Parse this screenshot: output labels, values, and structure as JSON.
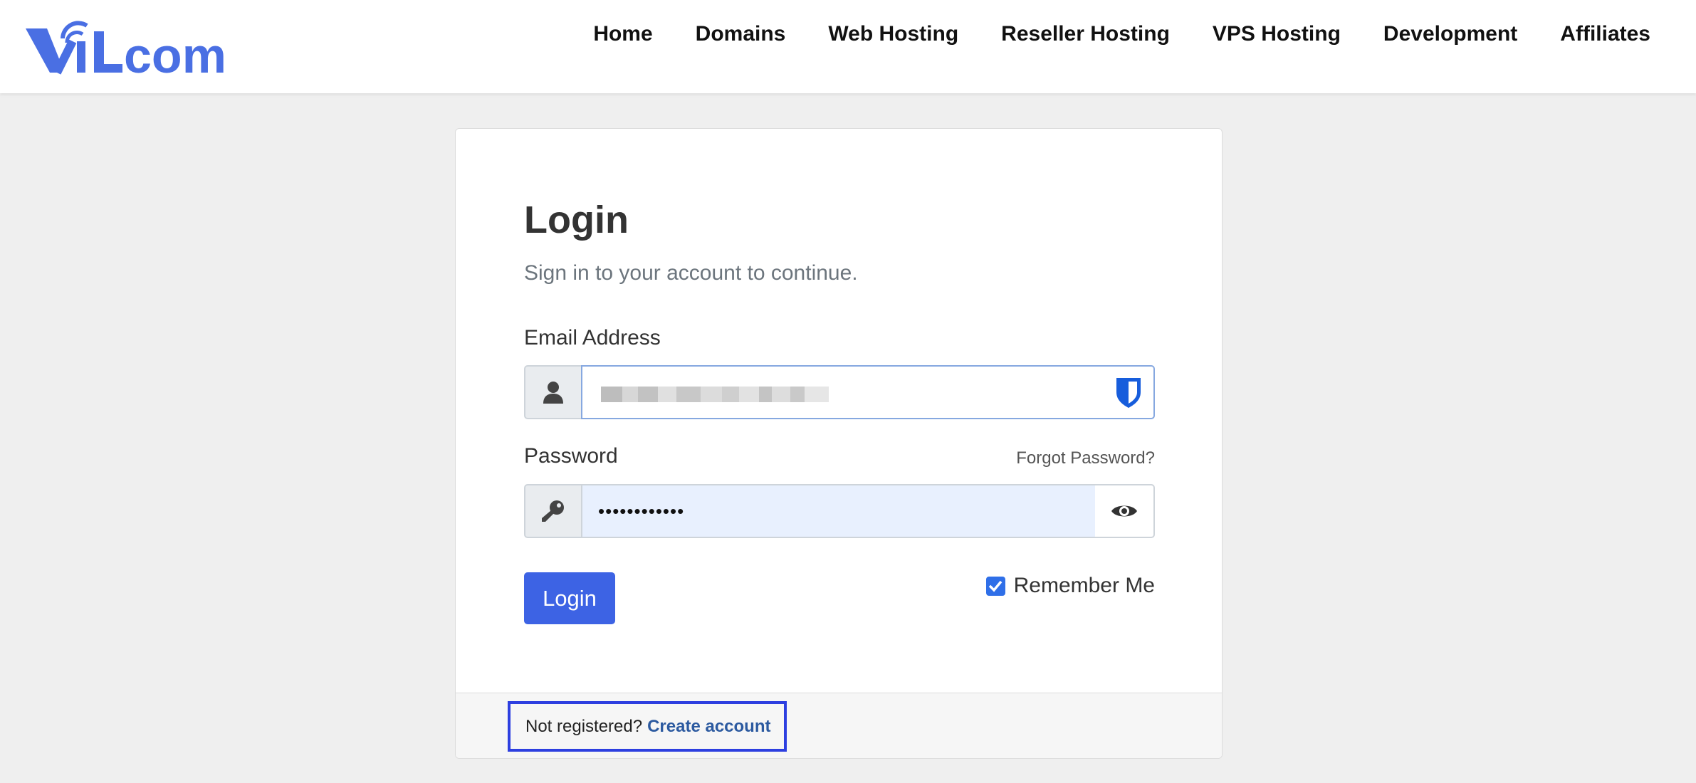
{
  "header": {
    "logo_text": "ViLcom",
    "nav": [
      "Home",
      "Domains",
      "Web Hosting",
      "Reseller Hosting",
      "VPS Hosting",
      "Development",
      "Affiliates"
    ]
  },
  "login": {
    "title": "Login",
    "subtitle": "Sign in to your account to continue.",
    "email_label": "Email Address",
    "password_label": "Password",
    "forgot_link": "Forgot Password?",
    "password_value": "••••••••••••",
    "login_button": "Login",
    "remember_label": "Remember Me",
    "remember_checked": true
  },
  "footer": {
    "not_registered": "Not registered?",
    "create_account": "Create account"
  },
  "icons": {
    "email_addon": "user-icon",
    "password_addon": "key-icon",
    "password_toggle": "eye-icon",
    "password_manager": "bitwarden-shield-icon"
  },
  "colors": {
    "brand": "#4a6fe3",
    "primary_button": "#3d63e4",
    "link": "#2c5aa0",
    "highlight_box": "#2d3fe0"
  }
}
